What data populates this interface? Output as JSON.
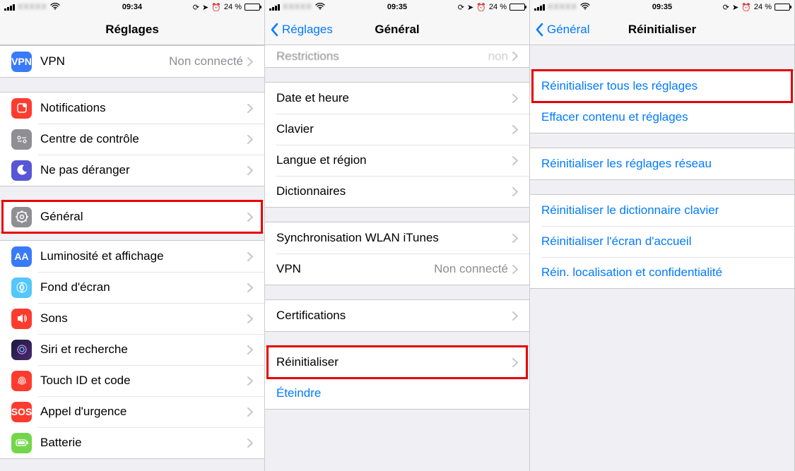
{
  "status": {
    "signal_label": "signal",
    "carrier_blur": "XXXXX",
    "wifi_label": "wifi",
    "battery_pct": "24 %",
    "time_p1": "09:34",
    "time_p2": "09:35",
    "time_p3": "09:35"
  },
  "p1": {
    "title": "Réglages",
    "rows": {
      "vpn": "VPN",
      "vpn_detail": "Non connecté",
      "notifications": "Notifications",
      "control_center": "Centre de contrôle",
      "dnd": "Ne pas déranger",
      "general": "Général",
      "display": "Luminosité et affichage",
      "wallpaper": "Fond d'écran",
      "sounds": "Sons",
      "siri": "Siri et recherche",
      "touchid": "Touch ID et code",
      "sos": "Appel d'urgence",
      "battery": "Batterie"
    }
  },
  "p2": {
    "back": "Réglages",
    "title": "Général",
    "cut_row": {
      "label": "Restrictions",
      "detail": "non"
    },
    "rows": {
      "datetime": "Date et heure",
      "keyboard": "Clavier",
      "language": "Langue et région",
      "dict": "Dictionnaires",
      "sync": "Synchronisation WLAN iTunes",
      "vpn": "VPN",
      "vpn_detail": "Non connecté",
      "cert": "Certifications",
      "reset": "Réinitialiser",
      "shutdown": "Éteindre"
    }
  },
  "p3": {
    "back": "Général",
    "title": "Réinitialiser",
    "rows": {
      "reset_all": "Réinitialiser tous les réglages",
      "erase_all": "Effacer contenu et réglages",
      "reset_network": "Réinitialiser les réglages réseau",
      "reset_keyboard": "Réinitialiser le dictionnaire clavier",
      "reset_home": "Réinitialiser l'écran d'accueil",
      "reset_location": "Réin. localisation et confidentialité"
    }
  },
  "icons": {
    "sos_text": "SOS",
    "vpn_text": "VPN",
    "aa_text": "AA"
  }
}
